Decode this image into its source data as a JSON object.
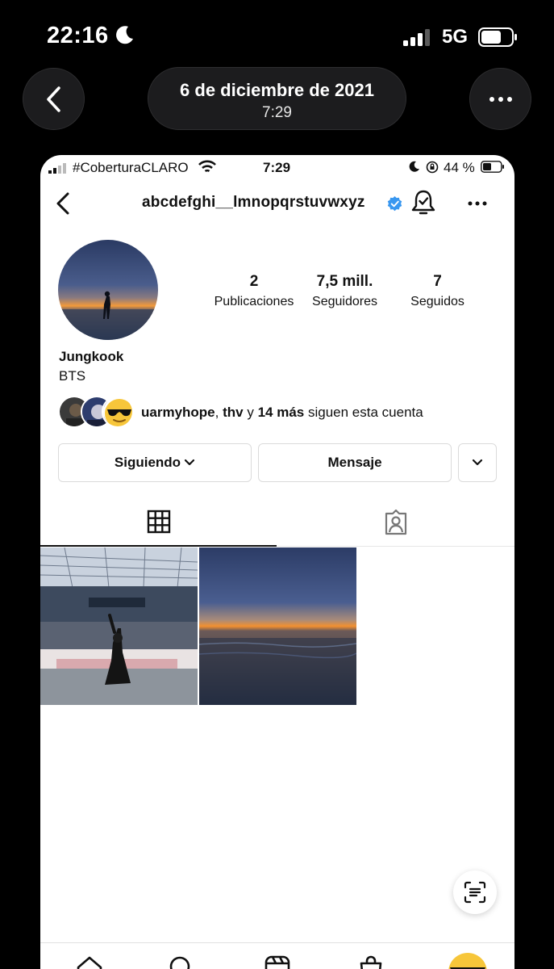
{
  "os_status": {
    "time": "22:16",
    "network": "5G",
    "moon_icon": "moon-icon",
    "signal_icon": "cellular-signal-icon",
    "battery_icon": "battery-icon"
  },
  "viewer": {
    "date": "6 de diciembre de 2021",
    "time": "7:29",
    "back_icon": "chevron-left-icon",
    "more_icon": "ellipsis-icon"
  },
  "screenshot": {
    "status": {
      "carrier": "#CoberturaCLARO",
      "time": "7:29",
      "battery": "44 %"
    },
    "header": {
      "username": "abcdefghi__lmnopqrstuvwxyz",
      "verified": true
    },
    "profile": {
      "stats": [
        {
          "value": "2",
          "label": "Publicaciones"
        },
        {
          "value": "7,5 mill.",
          "label": "Seguidores"
        },
        {
          "value": "7",
          "label": "Seguidos"
        }
      ],
      "name": "Jungkook",
      "bio": "BTS"
    },
    "followed_by": {
      "user1": "uarmyhope",
      "sep": ",",
      "user2": "thv",
      "and": "y",
      "count": "14 más",
      "suffix": "siguen esta cuenta"
    },
    "buttons": {
      "following": "Siguiendo",
      "message": "Mensaje"
    },
    "tabs": [
      {
        "icon": "grid-icon",
        "active": true
      },
      {
        "icon": "tagged-person-icon",
        "active": false
      }
    ],
    "posts": [
      {
        "description": "stadium-photo"
      },
      {
        "description": "sunset-beach-photo"
      }
    ],
    "bottom_nav": [
      "home-icon",
      "search-icon",
      "reels-icon",
      "shop-icon",
      "profile-avatar"
    ]
  }
}
